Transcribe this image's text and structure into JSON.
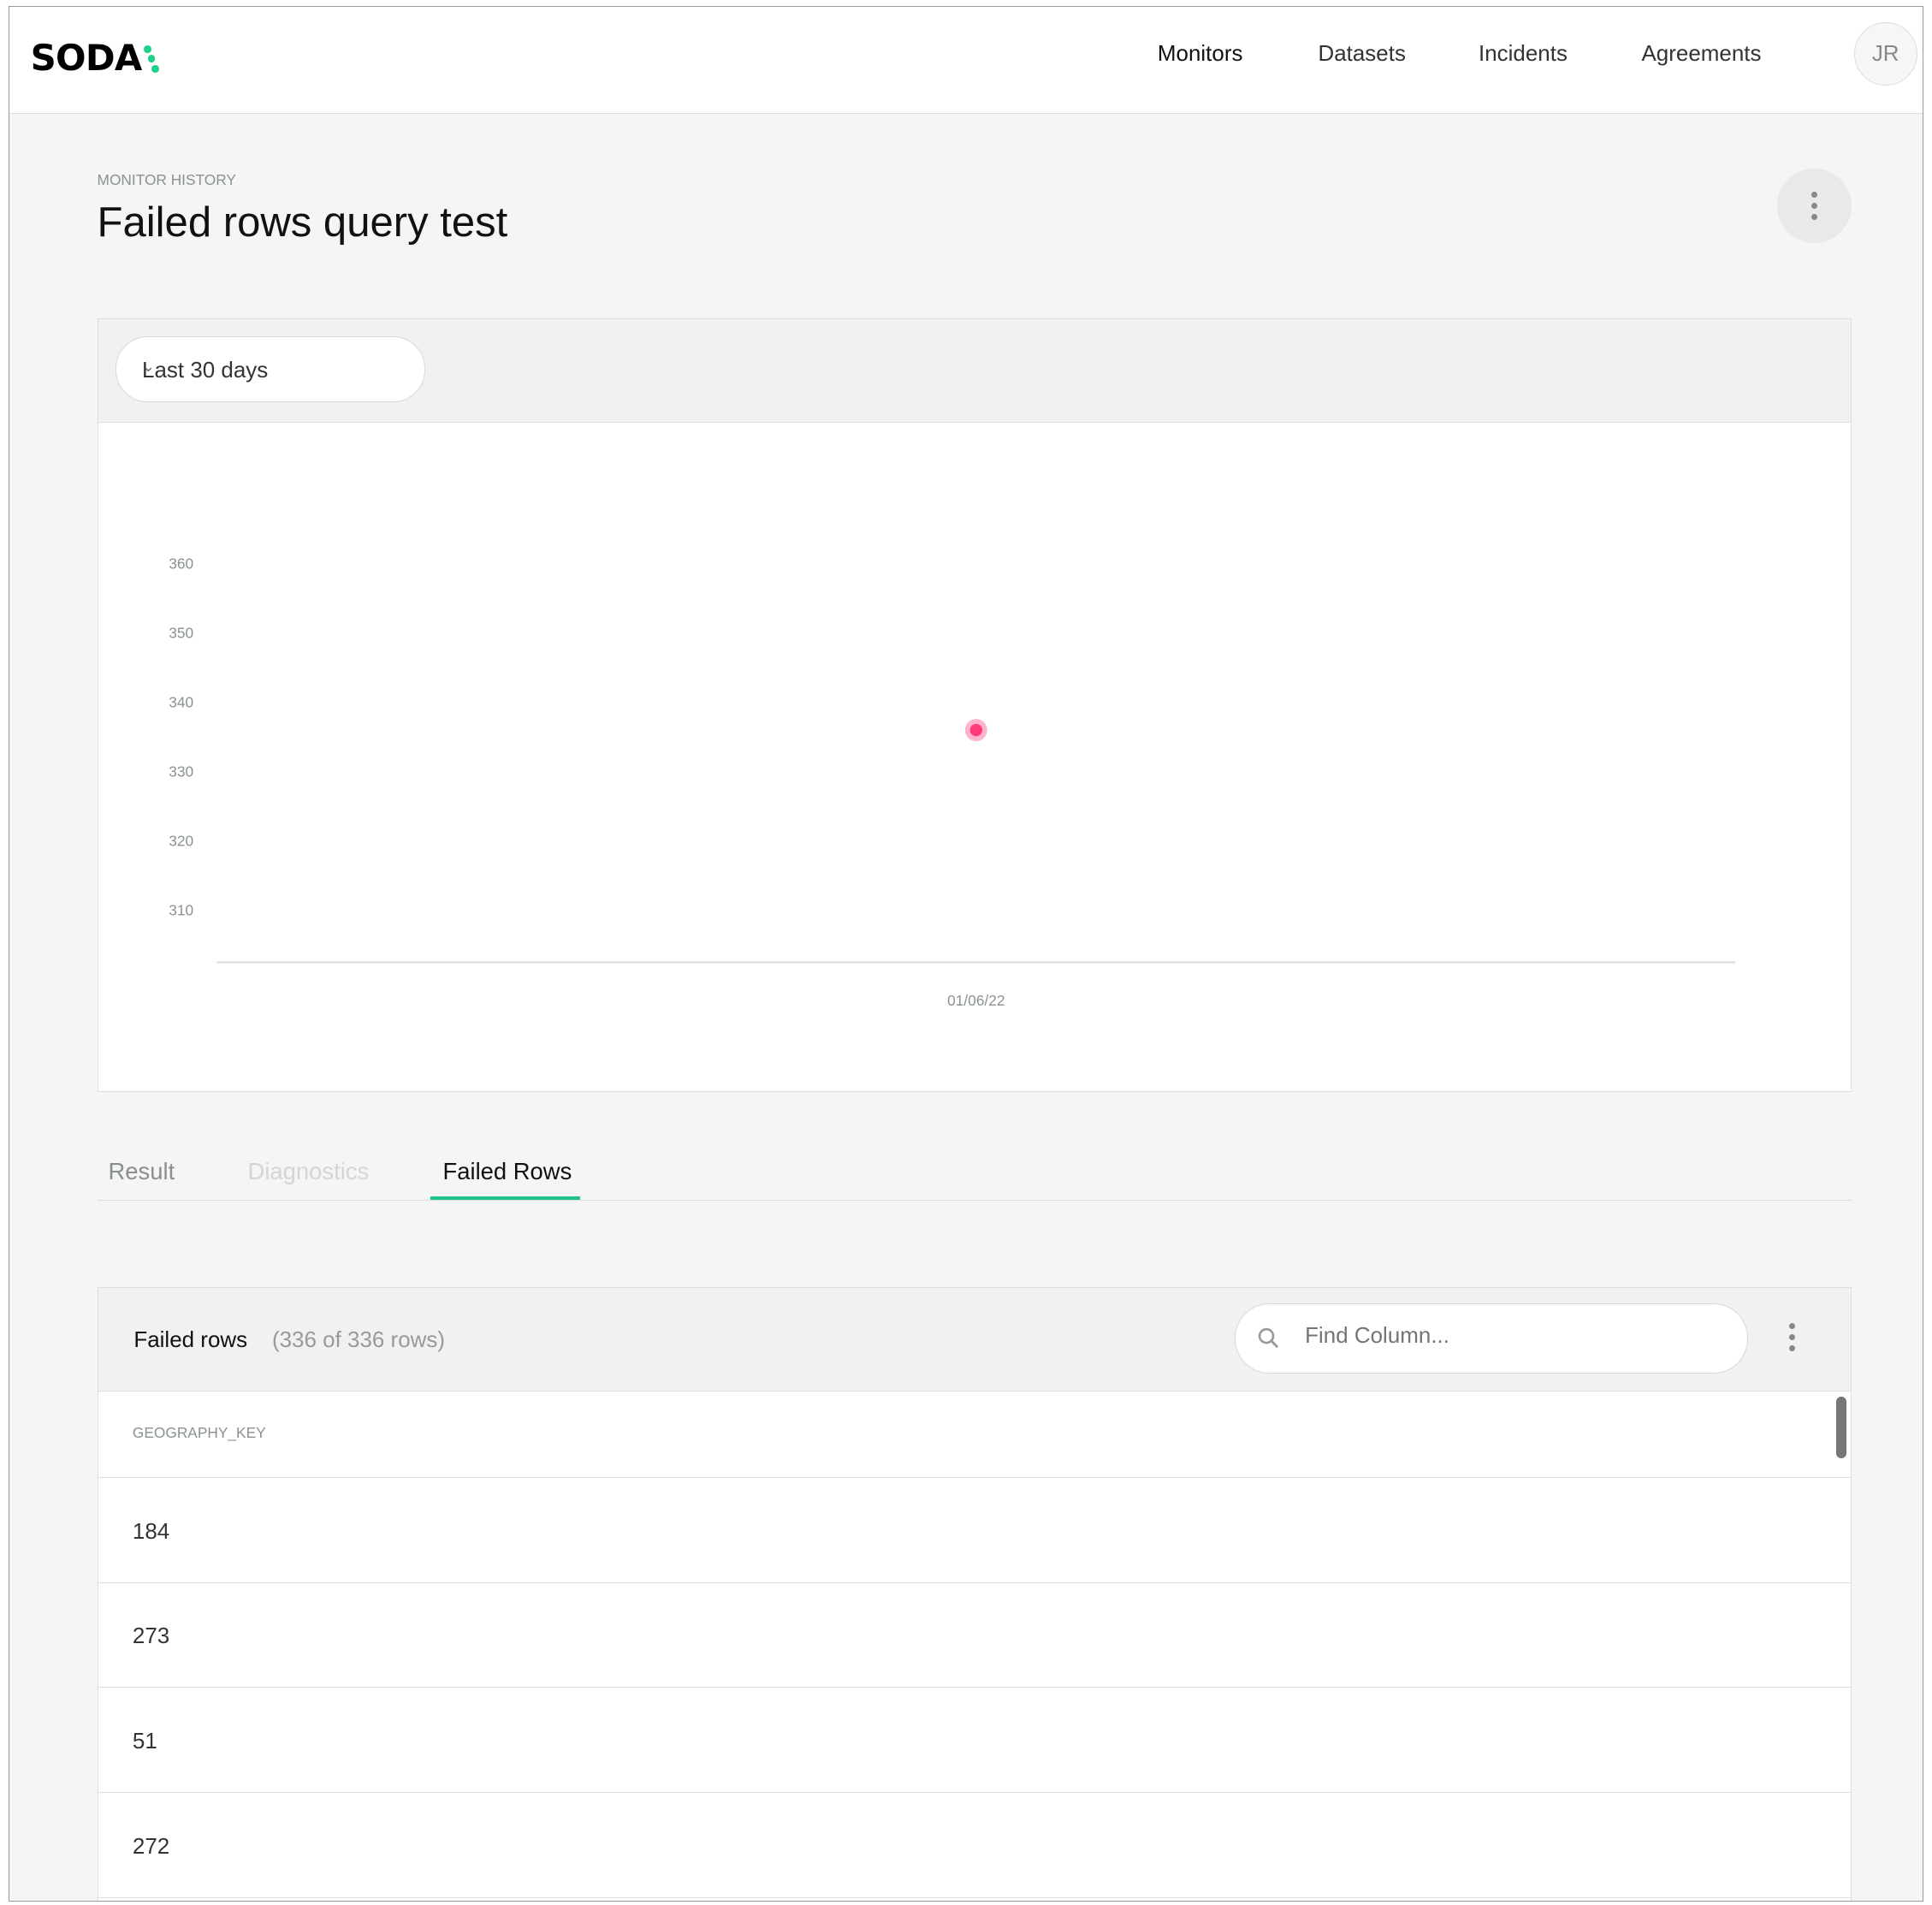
{
  "header": {
    "logo": "SODA",
    "nav": [
      "Monitors",
      "Datasets",
      "Incidents",
      "Agreements"
    ],
    "avatar_initials": "JR",
    "brand_color": "#1fd18a"
  },
  "page": {
    "breadcrumb": "MONITOR HISTORY",
    "title": "Failed rows query test"
  },
  "filter": {
    "selected": "Last 30 days"
  },
  "chart_data": {
    "type": "scatter",
    "x_ticks": [
      "01/06/22"
    ],
    "y_ticks": [
      310,
      320,
      330,
      340,
      350,
      360
    ],
    "ylim": [
      302,
      366
    ],
    "points": [
      {
        "x": "01/06/22",
        "y": 336
      }
    ],
    "point_color": "#ff3b7a",
    "grid": false
  },
  "tabs": [
    {
      "label": "Result",
      "state": "normal"
    },
    {
      "label": "Diagnostics",
      "state": "disabled"
    },
    {
      "label": "Failed Rows",
      "state": "active"
    }
  ],
  "failed_rows": {
    "title": "Failed rows",
    "count": "(336 of 336 rows)",
    "search_placeholder": "Find Column...",
    "column": "GEOGRAPHY_KEY",
    "rows": [
      "184",
      "273",
      "51",
      "272"
    ]
  }
}
